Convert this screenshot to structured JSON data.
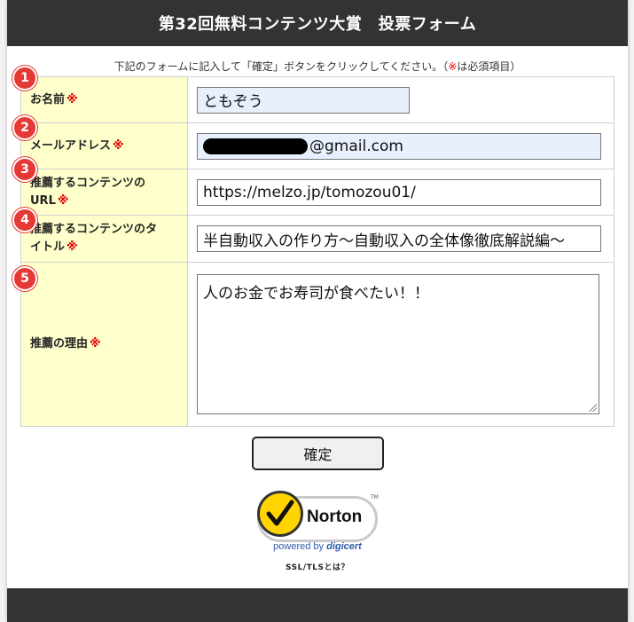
{
  "header": {
    "title": "第32回無料コンテンツ大賞　投票フォーム"
  },
  "intro": {
    "text_before": "下記のフォームに記入して「確定」ボタンをクリックしてください。（",
    "req_mark": "※",
    "text_after": "は必須項目）"
  },
  "required_mark": "※",
  "fields": [
    {
      "number": "1",
      "label": "お名前",
      "value": "ともぞう"
    },
    {
      "number": "2",
      "label": "メールアドレス",
      "value": "@gmail.com"
    },
    {
      "number": "3",
      "label_line1": "推薦するコンテンツの",
      "label_line2": "URL",
      "value": "https://melzo.jp/tomozou01/"
    },
    {
      "number": "4",
      "label_line1": "推薦するコンテンツのタ",
      "label_line2": "イトル",
      "value": "半自動収入の作り方～自動収入の全体像徹底解説編～"
    },
    {
      "number": "5",
      "label": "推薦の理由",
      "value": "人のお金でお寿司が食べたい！！"
    }
  ],
  "confirm_button": {
    "label": "確定"
  },
  "badge": {
    "brand": "Norton",
    "tm": "TM",
    "powered_by": "powered by",
    "digicert": "digicert",
    "ssl_link": "SSL/TLSとは？"
  },
  "colors": {
    "header_bg": "#333333",
    "label_bg": "#ffffcc",
    "required": "#e00000",
    "marker": "#e53935"
  }
}
